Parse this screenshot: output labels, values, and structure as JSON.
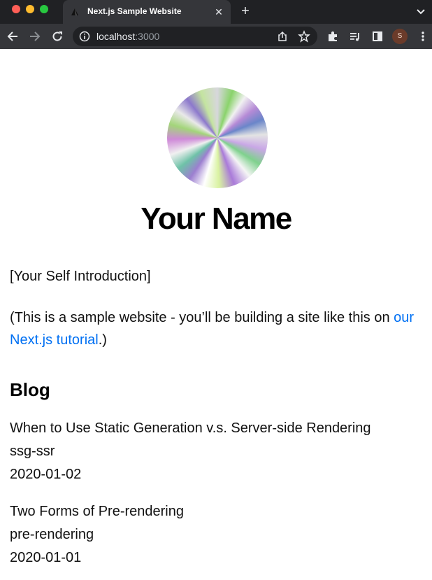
{
  "browser": {
    "tab_title": "Next.js Sample Website",
    "tab_close": "✕",
    "new_tab": "+",
    "url_host": "localhost",
    "url_port": ":3000",
    "profile_initial": "S"
  },
  "page": {
    "name": "Your Name",
    "intro": "[Your Self Introduction]",
    "note_prefix": "(This is a sample website - you’ll be building a site like this on ",
    "note_link": "our Next.js tutorial",
    "note_suffix": ".)",
    "blog_heading": "Blog",
    "posts": [
      {
        "title": "When to Use Static Generation v.s. Server-side Rendering",
        "id": "ssg-ssr",
        "date": "2020-01-02"
      },
      {
        "title": "Two Forms of Pre-rendering",
        "id": "pre-rendering",
        "date": "2020-01-01"
      }
    ]
  },
  "colors": {
    "link": "#0070f3",
    "chrome_dark": "#202124",
    "chrome_tab": "#35363a"
  }
}
